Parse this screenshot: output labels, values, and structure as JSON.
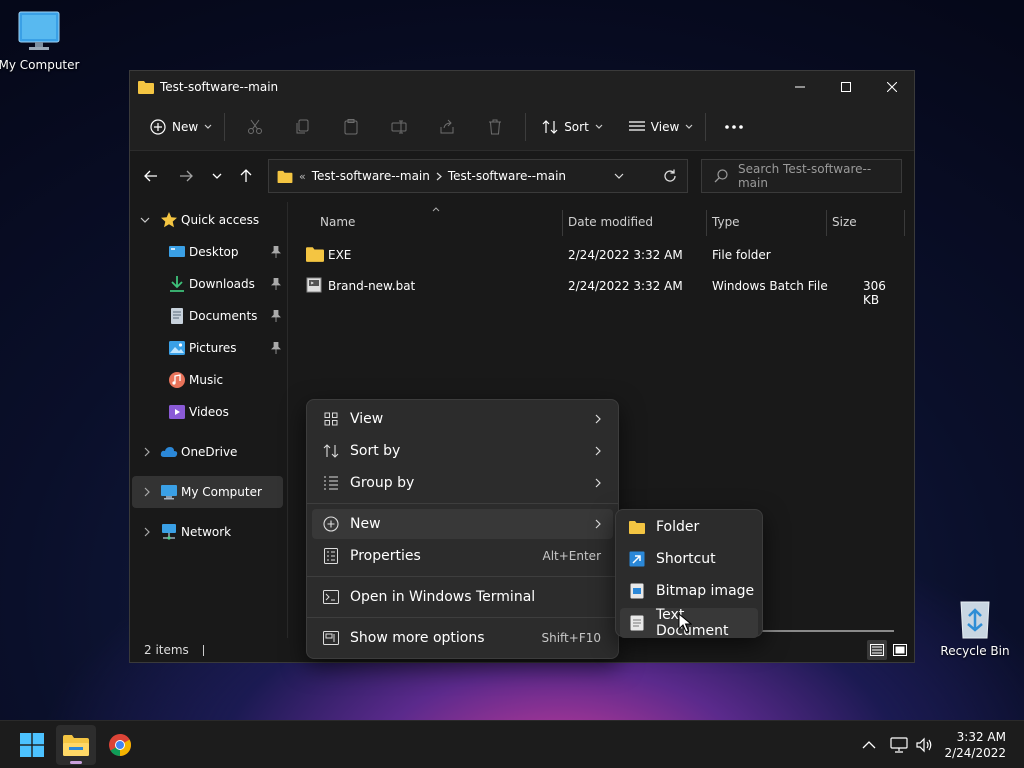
{
  "desktop": {
    "my_computer_label": "My Computer",
    "recycle_bin_label": "Recycle Bin"
  },
  "window": {
    "title": "Test-software--main",
    "controls": [
      "minimize-icon",
      "maximize-icon",
      "close-icon"
    ]
  },
  "toolbar": {
    "new_label": "New",
    "sort_label": "Sort",
    "view_label": "View",
    "more_label": "..."
  },
  "address": {
    "overflow": "«",
    "crumbs": [
      "Test-software--main",
      "Test-software--main"
    ],
    "search_placeholder": "Search Test-software--main"
  },
  "sidebar": {
    "items": [
      {
        "label": "Quick access",
        "icon": "star-icon"
      },
      {
        "label": "Desktop",
        "icon": "desktop-icon",
        "pinned": true
      },
      {
        "label": "Downloads",
        "icon": "download-icon",
        "pinned": true
      },
      {
        "label": "Documents",
        "icon": "documents-icon",
        "pinned": true
      },
      {
        "label": "Pictures",
        "icon": "pictures-icon",
        "pinned": true
      },
      {
        "label": "Music",
        "icon": "music-icon"
      },
      {
        "label": "Videos",
        "icon": "videos-icon"
      },
      {
        "label": "OneDrive",
        "icon": "cloud-icon"
      },
      {
        "label": "My Computer",
        "icon": "computer-icon",
        "selected": true
      },
      {
        "label": "Network",
        "icon": "network-icon"
      }
    ]
  },
  "columns": {
    "name": "Name",
    "date": "Date modified",
    "type": "Type",
    "size": "Size"
  },
  "files": [
    {
      "name": "EXE",
      "date": "2/24/2022 3:32 AM",
      "type": "File folder",
      "size": ""
    },
    {
      "name": "Brand-new.bat",
      "date": "2/24/2022 3:32 AM",
      "type": "Windows Batch File",
      "size": "306 KB"
    }
  ],
  "status": {
    "count": "2 items"
  },
  "context_menu": {
    "view": "View",
    "sort_by": "Sort by",
    "group_by": "Group by",
    "new": "New",
    "properties": "Properties",
    "properties_key": "Alt+Enter",
    "terminal": "Open in Windows Terminal",
    "more_options": "Show more options",
    "more_options_key": "Shift+F10"
  },
  "new_submenu": {
    "folder": "Folder",
    "shortcut": "Shortcut",
    "bitmap": "Bitmap image",
    "text": "Text Document"
  },
  "taskbar": {
    "time": "3:32 AM",
    "date": "2/24/2022"
  },
  "colors": {
    "accent": "#0078d4",
    "folder": "#f4c542",
    "window_bg": "#191919",
    "menu_bg": "#2c2c2c"
  }
}
